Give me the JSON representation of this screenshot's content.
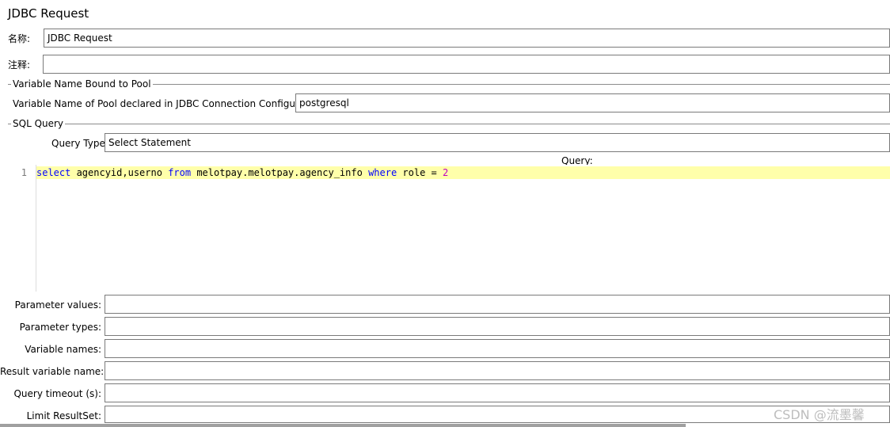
{
  "panel": {
    "title": "JDBC Request"
  },
  "name": {
    "label": "名称:",
    "value": "JDBC Request"
  },
  "comment": {
    "label": "注释:",
    "value": ""
  },
  "pool_group": {
    "title": "Variable Name Bound to Pool",
    "pool_label": "Variable Name of Pool declared in JDBC Connection Configuration:",
    "pool_value": "postgresql"
  },
  "sql_group": {
    "title": "SQL Query",
    "query_type_label": "Query Type:",
    "query_type_value": "Select Statement",
    "query_label": "Query:"
  },
  "editor": {
    "line_number": "1",
    "tokens": {
      "t1": "select",
      "t2": " agencyid,userno ",
      "t3": "from",
      "t4": " melotpay.melotpay.agency_info ",
      "t5": "where",
      "t6": " role = ",
      "t7": "2"
    }
  },
  "params": {
    "parameter_values_label": "Parameter values:",
    "parameter_types_label": "Parameter types:",
    "variable_names_label": "Variable names:",
    "result_variable_name_label": "Result variable name:",
    "query_timeout_label": "Query timeout (s):",
    "limit_resultset_label": "Limit ResultSet:"
  },
  "watermark": "CSDN @流墨馨",
  "colors": {
    "keyword": "#0000ff",
    "number": "#c000c0",
    "current_line_highlight": "#ffffaa"
  }
}
